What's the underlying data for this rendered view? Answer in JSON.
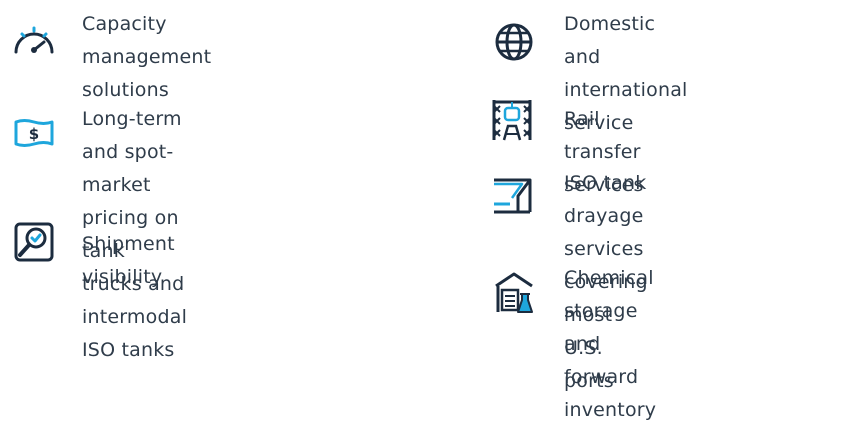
{
  "colors": {
    "text": "#2f3c4a",
    "icon_dark": "#1c2c3f",
    "icon_accent": "#1ea6dc"
  },
  "left_column": {
    "items": [
      {
        "icon": "speedometer-icon",
        "text": "Capacity management\nsolutions"
      },
      {
        "icon": "dollar-bill-icon",
        "text": "Long-term and spot-market\npricing on tank trucks and\nintermodal ISO tanks"
      },
      {
        "icon": "magnifier-check-icon",
        "text": "Shipment visibility"
      }
    ]
  },
  "right_column": {
    "items": [
      {
        "icon": "globe-icon",
        "text": "Domestic and\ninternational service"
      },
      {
        "icon": "rail-transfer-icon",
        "text": "Rail transfer services"
      },
      {
        "icon": "port-road-icon",
        "text": "ISO tank drayage services\ncovering most U.S. ports"
      },
      {
        "icon": "storage-flask-icon",
        "text": "Chemical storage and\nforward inventory"
      }
    ]
  }
}
